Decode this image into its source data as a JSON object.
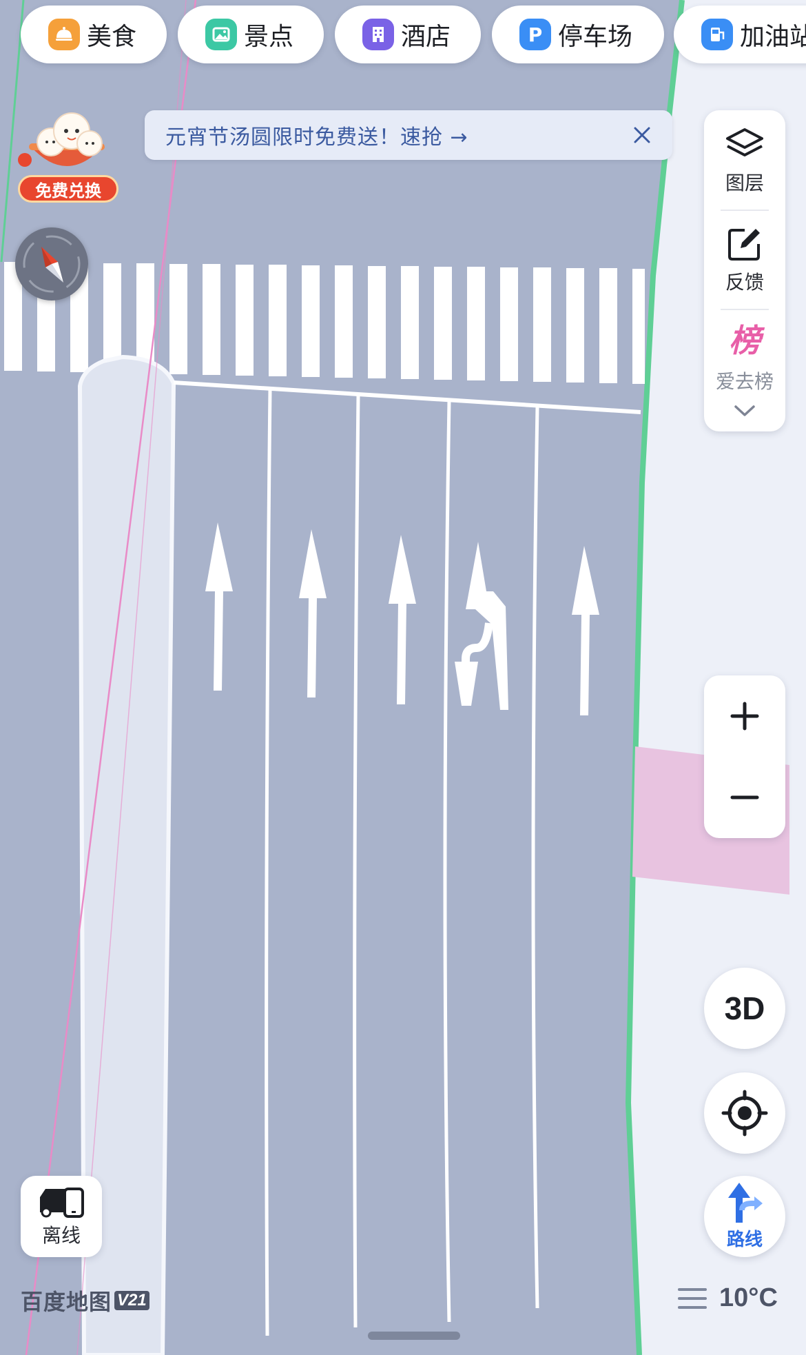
{
  "categories": [
    {
      "label": "美食",
      "icon": "food-icon",
      "color": "#f5a03a"
    },
    {
      "label": "景点",
      "icon": "scenery-icon",
      "color": "#3cc8a4"
    },
    {
      "label": "酒店",
      "icon": "hotel-icon",
      "color": "#7a62e6"
    },
    {
      "label": "停车场",
      "icon": "parking-icon",
      "color": "#3a8ef5"
    },
    {
      "label": "加油站",
      "icon": "gas-station-icon",
      "color": "#3a8ef5"
    }
  ],
  "banner": {
    "text": "元宵节汤圆限时免费送！速抢 →"
  },
  "promo": {
    "label": "免费兑换"
  },
  "side_panel": {
    "layers_label": "图层",
    "feedback_label": "反馈",
    "hot_icon_text": "榜",
    "hot_label": "爱去榜"
  },
  "map_buttons": {
    "three_d_label": "3D",
    "route_label": "路线",
    "offline_label": "离线"
  },
  "footer": {
    "brand": "百度地图",
    "version": "V21",
    "temperature": "10°C"
  },
  "colors": {
    "road": "#a9b3cb",
    "sidewalk": "#edf0f8",
    "green_edge": "#5fcf95",
    "pink_area": "#e8c3e0",
    "route_blue": "#2f6fe4"
  }
}
